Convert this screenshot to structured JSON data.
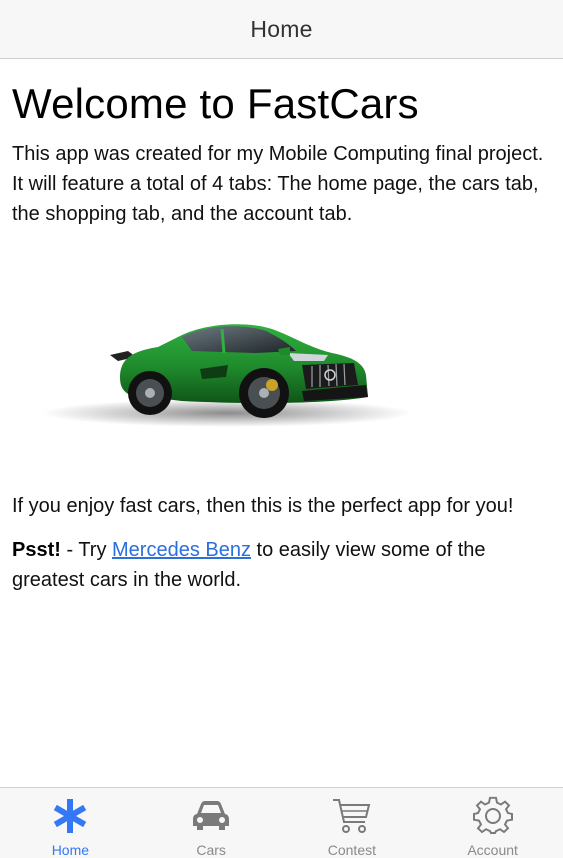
{
  "header": {
    "title": "Home"
  },
  "main": {
    "heading": "Welcome to FastCars",
    "intro": "This app was created for my Mobile Computing final project. It will feature a total of 4 tabs: The home page, the cars tab, the shopping tab, and the account tab.",
    "enjoy": "If you enjoy fast cars, then this is the perfect app for you!",
    "psst_bold": "Psst!",
    "psst_pre": " - Try ",
    "psst_link": "Mercedes Benz",
    "psst_post": " to easily view some of the greatest cars in the world."
  },
  "tabs": [
    {
      "label": "Home",
      "icon": "asterisk-icon",
      "active": true
    },
    {
      "label": "Cars",
      "icon": "car-icon",
      "active": false
    },
    {
      "label": "Contest",
      "icon": "cart-icon",
      "active": false
    },
    {
      "label": "Account",
      "icon": "gear-icon",
      "active": false
    }
  ],
  "colors": {
    "accent": "#3478f6",
    "link": "#2a6fdb",
    "car": "#1f8a2c"
  }
}
